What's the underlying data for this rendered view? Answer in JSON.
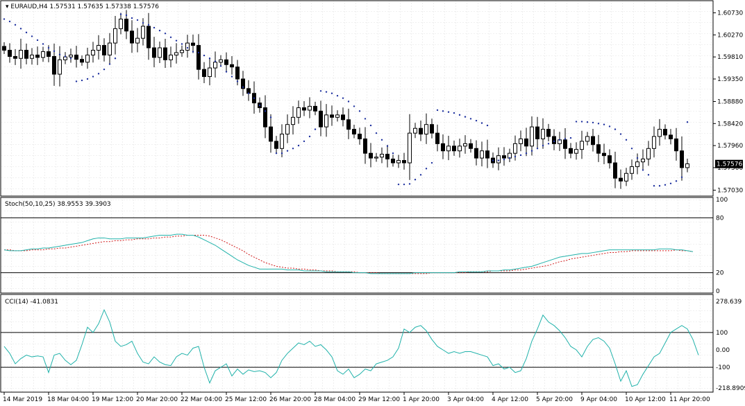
{
  "header": {
    "symbol": "EURAUD,H4",
    "ohlc": "1.57531 1.57635 1.57338 1.57576",
    "current_price": "1.57576"
  },
  "indicators": {
    "stoch": {
      "label": "Stoch(50,10,25) 38.9553 39.3903",
      "levels": [
        "100",
        "80",
        "20",
        "0"
      ]
    },
    "cci": {
      "label": "CCI(14) -41.0831",
      "levels": [
        "278.639",
        "100",
        "0.00",
        "-100",
        "-218.8909"
      ]
    }
  },
  "colors": {
    "bull_candle": "#ffffff",
    "bear_candle": "#000000",
    "sar_dots": "#1c2f9e",
    "stoch_main": "#20b2aa",
    "stoch_signal": "#d01818",
    "cci_line": "#20b2aa",
    "price_tag_bg": "#000000",
    "price_tag_fg": "#ffffff"
  },
  "chart_data": [
    {
      "type": "candlestick",
      "title": "EURAUD,H4",
      "ylim": [
        1.5695,
        1.6094
      ],
      "y_ticks": [
        "1.60730",
        "1.60270",
        "1.59810",
        "1.59350",
        "1.58880",
        "1.58420",
        "1.57960",
        "1.57500",
        "1.57030"
      ],
      "y_tick_values": [
        1.6073,
        1.6027,
        1.5981,
        1.5935,
        1.5888,
        1.5842,
        1.5796,
        1.575,
        1.5703
      ],
      "x_ticks": [
        "14 Mar 2019",
        "18 Mar 04:00",
        "19 Mar 12:00",
        "20 Mar 20:00",
        "22 Mar 04:00",
        "25 Mar 12:00",
        "26 Mar 20:00",
        "28 Mar 04:00",
        "29 Mar 12:00",
        "1 Apr 20:00",
        "3 Apr 04:00",
        "4 Apr 12:00",
        "5 Apr 20:00",
        "9 Apr 04:00",
        "10 Apr 12:00",
        "11 Apr 20:00"
      ],
      "x_tick_bars": [
        0,
        8,
        16,
        24,
        32,
        40,
        48,
        56,
        64,
        72,
        80,
        88,
        96,
        104,
        112,
        120
      ],
      "closes": [
        1.5995,
        1.5982,
        1.5978,
        1.5995,
        1.5978,
        1.5985,
        1.598,
        1.5992,
        1.5982,
        1.5945,
        1.5975,
        1.5981,
        1.5985,
        1.5976,
        1.597,
        1.5985,
        1.5995,
        1.6005,
        1.5985,
        1.601,
        1.604,
        1.606,
        1.6035,
        1.601,
        1.602,
        1.6045,
        1.6,
        1.598,
        1.6,
        1.5975,
        1.5985,
        1.599,
        1.5995,
        1.601,
        1.6005,
        1.5955,
        1.594,
        1.5958,
        1.597,
        1.5975,
        1.5965,
        1.596,
        1.5935,
        1.5915,
        1.5905,
        1.5885,
        1.5875,
        1.5835,
        1.5805,
        1.579,
        1.582,
        1.584,
        1.5855,
        1.5875,
        1.587,
        1.5878,
        1.5868,
        1.5835,
        1.586,
        1.5855,
        1.586,
        1.585,
        1.583,
        1.582,
        1.581,
        1.578,
        1.577,
        1.5772,
        1.5778,
        1.5768,
        1.576,
        1.5765,
        1.576,
        1.5822,
        1.5832,
        1.582,
        1.584,
        1.5822,
        1.58,
        1.5785,
        1.5795,
        1.5785,
        1.5795,
        1.58,
        1.579,
        1.577,
        1.5785,
        1.577,
        1.576,
        1.5775,
        1.577,
        1.578,
        1.58,
        1.581,
        1.5795,
        1.5835,
        1.581,
        1.583,
        1.5815,
        1.58,
        1.5808,
        1.579,
        1.578,
        1.5788,
        1.5805,
        1.5815,
        1.5798,
        1.578,
        1.5775,
        1.576,
        1.5728,
        1.5722,
        1.5738,
        1.5752,
        1.5762,
        1.5768,
        1.579,
        1.5815,
        1.583,
        1.5818,
        1.581,
        1.5785,
        1.575,
        1.5758
      ],
      "sar": [
        1.606,
        1.6055,
        1.6048,
        1.604,
        1.6032,
        1.6024,
        1.6016,
        1.6008,
        1.6,
        1.5993,
        1.5986,
        1.5982,
        1.5978,
        1.593,
        1.5932,
        1.5935,
        1.594,
        1.5946,
        1.5955,
        1.5966,
        1.5978,
        1.607,
        1.6068,
        1.6062,
        1.6058,
        1.6052,
        1.6048,
        1.6042,
        1.6036,
        1.603,
        1.6022,
        1.6015,
        1.6008,
        1.6,
        1.5992,
        1.599,
        1.5984,
        1.5978,
        1.5972,
        1.5962,
        1.595,
        1.594,
        1.593,
        1.5918,
        1.5905,
        1.5895,
        1.588,
        1.5868,
        1.5855,
        1.578,
        1.578,
        1.5785,
        1.579,
        1.5796,
        1.5805,
        1.5815,
        1.583,
        1.591,
        1.5908,
        1.5905,
        1.59,
        1.5895,
        1.5888,
        1.5878,
        1.5868,
        1.5852,
        1.5838,
        1.5822,
        1.5808,
        1.5795,
        1.578,
        1.5715,
        1.5715,
        1.5716,
        1.5725,
        1.5735,
        1.5748,
        1.576,
        1.587,
        1.5868,
        1.5866,
        1.5864,
        1.586,
        1.5856,
        1.5852,
        1.5848,
        1.5843,
        1.5838,
        1.5765,
        1.5765,
        1.5767,
        1.577,
        1.5773,
        1.5776,
        1.578,
        1.5785,
        1.579,
        1.5796,
        1.58,
        1.5805,
        1.5808,
        1.581,
        1.5812,
        1.5846,
        1.5846,
        1.5845,
        1.5844,
        1.5842,
        1.584,
        1.5836,
        1.583,
        1.582,
        1.5808,
        1.579,
        1.577,
        1.5745,
        1.5735,
        1.5712,
        1.5712,
        1.5714,
        1.5717,
        1.5722,
        1.573,
        1.5845
      ]
    },
    {
      "type": "line",
      "title": "Stoch(50,10,25)",
      "ylim": [
        0,
        100
      ],
      "levels": [
        80,
        20
      ],
      "series": [
        {
          "name": "main",
          "values": [
            45,
            44,
            44,
            44,
            45,
            46,
            46,
            47,
            47,
            48,
            49,
            50,
            51,
            52,
            53,
            55,
            57,
            58,
            58,
            57,
            57,
            57,
            58,
            58,
            58,
            58,
            59,
            60,
            61,
            61,
            61,
            62,
            62,
            61,
            61,
            59,
            56,
            53,
            50,
            46,
            42,
            38,
            34,
            31,
            28,
            26,
            24,
            24,
            24,
            24,
            24,
            23,
            23,
            23,
            22,
            22,
            22,
            22,
            21,
            21,
            21,
            21,
            21,
            20,
            20,
            20,
            19,
            19,
            19,
            19,
            19,
            19,
            19,
            19,
            20,
            20,
            20,
            20,
            20,
            20,
            20,
            20,
            21,
            21,
            21,
            21,
            21,
            22,
            22,
            22,
            23,
            23,
            24,
            25,
            26,
            27,
            29,
            31,
            33,
            35,
            37,
            38,
            39,
            40,
            41,
            41,
            42,
            43,
            44,
            45,
            45,
            45,
            45,
            45,
            45,
            45,
            45,
            45,
            46,
            46,
            46,
            45,
            45,
            44,
            43
          ]
        },
        {
          "name": "signal",
          "values": [
            45,
            45,
            44,
            44,
            44,
            45,
            45,
            45,
            46,
            46,
            47,
            47,
            48,
            49,
            50,
            51,
            52,
            53,
            54,
            54,
            55,
            55,
            56,
            56,
            57,
            57,
            57,
            58,
            58,
            59,
            59,
            60,
            60,
            61,
            61,
            61,
            61,
            60,
            58,
            56,
            53,
            50,
            47,
            44,
            40,
            37,
            34,
            31,
            29,
            27,
            26,
            25,
            25,
            24,
            24,
            23,
            23,
            22,
            22,
            22,
            21,
            21,
            21,
            21,
            20,
            20,
            20,
            20,
            19,
            19,
            19,
            19,
            19,
            19,
            19,
            19,
            19,
            20,
            20,
            20,
            20,
            20,
            20,
            20,
            21,
            21,
            21,
            21,
            22,
            22,
            22,
            22,
            23,
            23,
            24,
            25,
            26,
            27,
            28,
            30,
            32,
            33,
            35,
            36,
            37,
            38,
            39,
            40,
            41,
            42,
            42,
            43,
            43,
            44,
            44,
            44,
            44,
            44,
            44,
            44,
            44,
            45,
            44,
            44,
            43
          ]
        }
      ]
    },
    {
      "type": "line",
      "title": "CCI(14)",
      "ylim": [
        -218.8909,
        278.639
      ],
      "levels": [
        100,
        0,
        -100
      ],
      "series": [
        {
          "name": "CCI",
          "values": [
            20,
            -20,
            -80,
            -50,
            -30,
            -40,
            -35,
            -40,
            -130,
            -30,
            -20,
            -60,
            -85,
            -60,
            30,
            130,
            100,
            150,
            230,
            160,
            50,
            20,
            30,
            50,
            -20,
            -70,
            -80,
            -40,
            -70,
            -85,
            -90,
            -40,
            -20,
            -30,
            10,
            20,
            -100,
            -190,
            -120,
            -100,
            -80,
            -150,
            -110,
            -140,
            -115,
            -125,
            -120,
            -130,
            -160,
            -130,
            -60,
            -20,
            10,
            40,
            30,
            50,
            20,
            30,
            0,
            -40,
            -120,
            -140,
            -110,
            -160,
            -140,
            -110,
            -120,
            -80,
            -70,
            -60,
            -40,
            10,
            120,
            100,
            130,
            140,
            110,
            60,
            20,
            0,
            -20,
            -10,
            -20,
            -10,
            -10,
            -20,
            -30,
            -40,
            -90,
            -80,
            -110,
            -100,
            -130,
            -120,
            -50,
            50,
            120,
            200,
            160,
            140,
            110,
            70,
            20,
            0,
            -40,
            20,
            60,
            70,
            50,
            10,
            -80,
            -180,
            -120,
            -210,
            -200,
            -140,
            -90,
            -40,
            -20,
            40,
            100,
            120,
            140,
            120,
            60,
            -30
          ]
        }
      ]
    }
  ]
}
